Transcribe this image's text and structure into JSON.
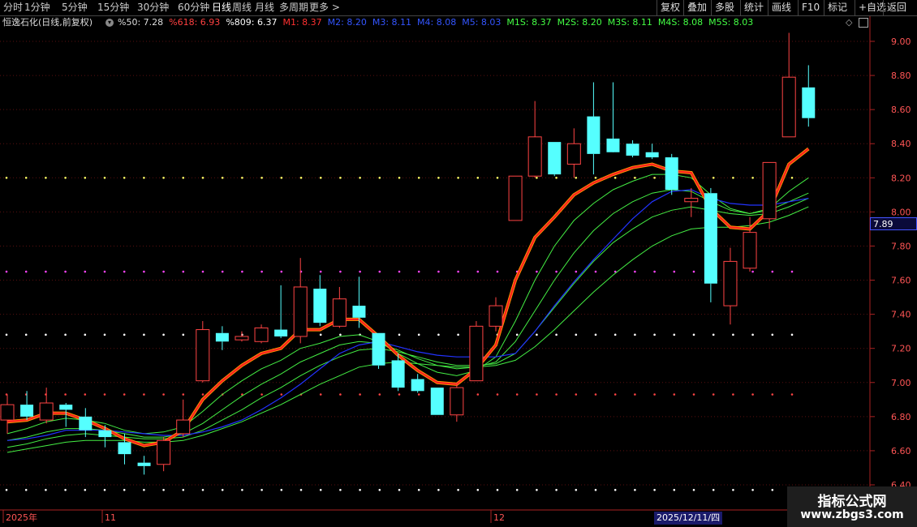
{
  "toolbar": {
    "period_tabs": [
      "分时",
      "1分钟",
      "5分钟",
      "15分钟",
      "30分钟",
      "60分钟",
      "日线",
      "周线",
      "月线",
      "多周期",
      "更多 >"
    ],
    "active_tab": "日线",
    "right_buttons": [
      "复权",
      "叠加",
      "多股",
      "统计",
      "画线",
      "F10",
      "标记",
      "+自选",
      "返回"
    ]
  },
  "stock": {
    "title": "恒逸石化(日线,前复权)"
  },
  "legend": [
    {
      "label": "%50: 7.28",
      "color": "#dddddd"
    },
    {
      "label": "%618: 6.93",
      "color": "#ff4040"
    },
    {
      "label": "%809: 6.37",
      "color": "#ffffff"
    },
    {
      "label": "M1: 8.37",
      "color": "#ff3030"
    },
    {
      "label": "M2: 8.20",
      "color": "#3355ff"
    },
    {
      "label": "M3: 8.11",
      "color": "#3355ff"
    },
    {
      "label": "M4: 8.08",
      "color": "#3355ff"
    },
    {
      "label": "M5: 8.03",
      "color": "#3355ff"
    },
    {
      "label": "M1S: 8.37",
      "color": "#44ff44"
    },
    {
      "label": "M2S: 8.20",
      "color": "#44ff44"
    },
    {
      "label": "M3S: 8.11",
      "color": "#44ff44"
    },
    {
      "label": "M4S: 8.08",
      "color": "#44ff44"
    },
    {
      "label": "M5S: 8.03",
      "color": "#44ff44"
    }
  ],
  "current_price": "7.89",
  "xaxis": {
    "labels": [
      "2025年",
      "11",
      "12"
    ],
    "cursor_date": "2025/12/11/四"
  },
  "watermark": {
    "line1": "指标公式网",
    "line2": "www.zbgs3.com"
  },
  "colors": {
    "up": "#ff4444",
    "down": "#55ffff",
    "m1": "#ff2020",
    "m1_glow": "#ff9900",
    "blue": "#2233ff",
    "green": "#44ee44",
    "axis": "#aa2222"
  },
  "chart_data": {
    "type": "candlestick",
    "ylim": [
      6.4,
      9.1
    ],
    "yticks": [
      9.0,
      8.8,
      8.6,
      8.4,
      8.2,
      8.0,
      7.8,
      7.6,
      7.4,
      7.2,
      7.0,
      6.8,
      6.6,
      6.4
    ],
    "dotted_levels": [
      {
        "y": 8.2,
        "color": "#ffff66"
      },
      {
        "y": 7.65,
        "color": "#ff44ff"
      },
      {
        "y": 7.28,
        "color": "#ffffff"
      },
      {
        "y": 6.93,
        "color": "#ff4444"
      },
      {
        "y": 6.37,
        "color": "#ffffff"
      }
    ],
    "candles": [
      {
        "o": 6.78,
        "h": 6.93,
        "l": 6.7,
        "c": 6.87
      },
      {
        "o": 6.87,
        "h": 6.95,
        "l": 6.78,
        "c": 6.8
      },
      {
        "o": 6.78,
        "h": 6.97,
        "l": 6.76,
        "c": 6.88
      },
      {
        "o": 6.87,
        "h": 6.88,
        "l": 6.74,
        "c": 6.84
      },
      {
        "o": 6.8,
        "h": 6.85,
        "l": 6.68,
        "c": 6.72
      },
      {
        "o": 6.72,
        "h": 6.75,
        "l": 6.62,
        "c": 6.68
      },
      {
        "o": 6.65,
        "h": 6.7,
        "l": 6.52,
        "c": 6.58
      },
      {
        "o": 6.53,
        "h": 6.57,
        "l": 6.46,
        "c": 6.51
      },
      {
        "o": 6.52,
        "h": 6.68,
        "l": 6.48,
        "c": 6.66
      },
      {
        "o": 6.7,
        "h": 6.9,
        "l": 6.68,
        "c": 6.78
      },
      {
        "o": 7.01,
        "h": 7.36,
        "l": 7.0,
        "c": 7.31
      },
      {
        "o": 7.29,
        "h": 7.33,
        "l": 7.19,
        "c": 7.24
      },
      {
        "o": 7.25,
        "h": 7.3,
        "l": 7.24,
        "c": 7.27
      },
      {
        "o": 7.24,
        "h": 7.34,
        "l": 7.23,
        "c": 7.32
      },
      {
        "o": 7.31,
        "h": 7.57,
        "l": 7.26,
        "c": 7.27
      },
      {
        "o": 7.27,
        "h": 7.73,
        "l": 7.23,
        "c": 7.56
      },
      {
        "o": 7.55,
        "h": 7.63,
        "l": 7.33,
        "c": 7.35
      },
      {
        "o": 7.33,
        "h": 7.56,
        "l": 7.32,
        "c": 7.49
      },
      {
        "o": 7.45,
        "h": 7.62,
        "l": 7.32,
        "c": 7.38
      },
      {
        "o": 7.29,
        "h": 7.29,
        "l": 7.08,
        "c": 7.1
      },
      {
        "o": 7.13,
        "h": 7.17,
        "l": 6.95,
        "c": 6.97
      },
      {
        "o": 7.02,
        "h": 7.05,
        "l": 6.94,
        "c": 6.95
      },
      {
        "o": 6.97,
        "h": 6.97,
        "l": 6.81,
        "c": 6.81
      },
      {
        "o": 6.81,
        "h": 7.0,
        "l": 6.77,
        "c": 6.97
      },
      {
        "o": 7.01,
        "h": 7.36,
        "l": 7.01,
        "c": 7.33
      },
      {
        "o": 7.33,
        "h": 7.5,
        "l": 7.3,
        "c": 7.45
      },
      {
        "o": 7.95,
        "h": 8.21,
        "l": 7.95,
        "c": 8.21
      },
      {
        "o": 8.21,
        "h": 8.65,
        "l": 8.2,
        "c": 8.44
      },
      {
        "o": 8.41,
        "h": 8.41,
        "l": 8.21,
        "c": 8.22
      },
      {
        "o": 8.28,
        "h": 8.49,
        "l": 8.2,
        "c": 8.4
      },
      {
        "o": 8.56,
        "h": 8.76,
        "l": 8.22,
        "c": 8.34
      },
      {
        "o": 8.43,
        "h": 8.76,
        "l": 8.36,
        "c": 8.35
      },
      {
        "o": 8.4,
        "h": 8.42,
        "l": 8.32,
        "c": 8.33
      },
      {
        "o": 8.35,
        "h": 8.4,
        "l": 8.31,
        "c": 8.32
      },
      {
        "o": 8.32,
        "h": 8.34,
        "l": 8.1,
        "c": 8.13
      },
      {
        "o": 8.06,
        "h": 8.14,
        "l": 7.97,
        "c": 8.08
      },
      {
        "o": 8.11,
        "h": 8.14,
        "l": 7.47,
        "c": 7.58
      },
      {
        "o": 7.45,
        "h": 7.79,
        "l": 7.34,
        "c": 7.71
      },
      {
        "o": 7.67,
        "h": 7.97,
        "l": 7.65,
        "c": 7.88
      },
      {
        "o": 7.96,
        "h": 8.29,
        "l": 7.9,
        "c": 8.29
      },
      {
        "o": 8.44,
        "h": 9.05,
        "l": 8.44,
        "c": 8.79
      },
      {
        "o": 8.73,
        "h": 8.86,
        "l": 8.5,
        "c": 8.55
      }
    ],
    "m1": [
      6.77,
      6.78,
      6.82,
      6.82,
      6.78,
      6.73,
      6.67,
      6.63,
      6.65,
      6.72,
      6.9,
      7.01,
      7.1,
      7.17,
      7.2,
      7.31,
      7.31,
      7.37,
      7.37,
      7.27,
      7.16,
      7.07,
      7.0,
      6.99,
      7.08,
      7.22,
      7.6,
      7.85,
      7.97,
      8.1,
      8.17,
      8.22,
      8.26,
      8.28,
      8.24,
      8.23,
      8.02,
      7.91,
      7.9,
      8.01,
      8.28,
      8.37
    ],
    "m_blue": [
      6.66,
      6.67,
      6.69,
      6.72,
      6.72,
      6.72,
      6.71,
      6.7,
      6.69,
      6.69,
      6.71,
      6.74,
      6.78,
      6.84,
      6.91,
      6.99,
      7.08,
      7.17,
      7.22,
      7.24,
      7.21,
      7.18,
      7.16,
      7.15,
      7.15,
      7.15,
      7.17,
      7.3,
      7.45,
      7.59,
      7.72,
      7.84,
      7.96,
      8.06,
      8.12,
      8.13,
      8.08,
      8.05,
      8.04,
      8.04,
      8.06,
      8.08
    ],
    "m_green": [
      [
        6.7,
        6.73,
        6.77,
        6.79,
        6.78,
        6.76,
        6.72,
        6.7,
        6.71,
        6.74,
        6.83,
        6.93,
        7.01,
        7.08,
        7.13,
        7.2,
        7.23,
        7.27,
        7.28,
        7.24,
        7.17,
        7.11,
        7.06,
        7.04,
        7.07,
        7.15,
        7.36,
        7.6,
        7.8,
        7.95,
        8.05,
        8.13,
        8.18,
        8.22,
        8.22,
        8.2,
        8.1,
        8.02,
        7.99,
        8.02,
        8.12,
        8.2
      ],
      [
        6.66,
        6.68,
        6.71,
        6.73,
        6.73,
        6.72,
        6.7,
        6.68,
        6.68,
        6.7,
        6.76,
        6.84,
        6.92,
        6.99,
        7.05,
        7.12,
        7.17,
        7.22,
        7.24,
        7.23,
        7.19,
        7.14,
        7.1,
        7.08,
        7.09,
        7.12,
        7.24,
        7.42,
        7.6,
        7.76,
        7.89,
        7.99,
        8.06,
        8.11,
        8.13,
        8.12,
        8.06,
        8.01,
        7.99,
        8.01,
        8.06,
        8.11
      ],
      [
        6.62,
        6.64,
        6.67,
        6.69,
        6.7,
        6.69,
        6.68,
        6.67,
        6.67,
        6.68,
        6.72,
        6.78,
        6.84,
        6.91,
        6.97,
        7.04,
        7.1,
        7.15,
        7.19,
        7.2,
        7.18,
        7.15,
        7.12,
        7.1,
        7.1,
        7.11,
        7.17,
        7.3,
        7.44,
        7.58,
        7.71,
        7.82,
        7.9,
        7.97,
        8.01,
        8.03,
        8.01,
        7.99,
        7.98,
        7.99,
        8.03,
        8.08
      ],
      [
        6.59,
        6.61,
        6.63,
        6.65,
        6.66,
        6.66,
        6.66,
        6.65,
        6.65,
        6.66,
        6.69,
        6.73,
        6.77,
        6.82,
        6.87,
        6.93,
        6.99,
        7.04,
        7.09,
        7.11,
        7.12,
        7.11,
        7.1,
        7.09,
        7.09,
        7.1,
        7.13,
        7.21,
        7.31,
        7.42,
        7.53,
        7.63,
        7.72,
        7.8,
        7.86,
        7.9,
        7.91,
        7.91,
        7.92,
        7.94,
        7.98,
        8.03
      ]
    ]
  }
}
